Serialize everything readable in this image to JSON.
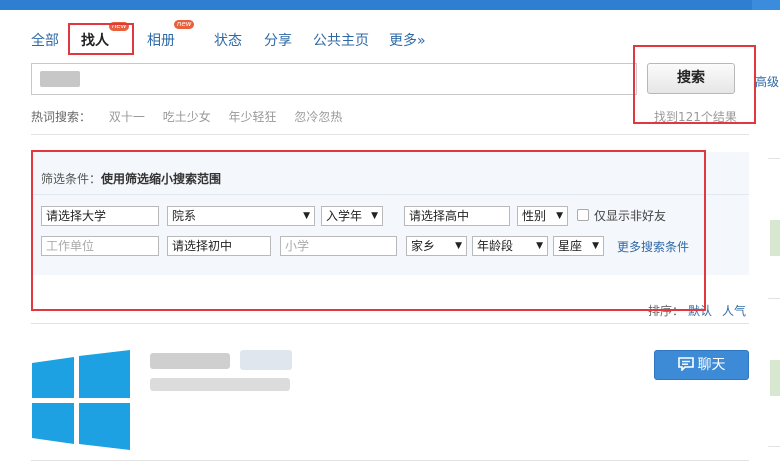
{
  "tabs": [
    {
      "label": "全部",
      "active": false
    },
    {
      "label": "找人",
      "active": true,
      "badge": "new"
    },
    {
      "label": "相册",
      "active": false,
      "badge": "new"
    },
    {
      "label": "状态",
      "active": false
    },
    {
      "label": "分享",
      "active": false
    },
    {
      "label": "公共主页",
      "active": false
    },
    {
      "label": "更多»",
      "active": false
    }
  ],
  "search": {
    "button_label": "搜索",
    "advanced_label": "高级",
    "hot_label": "热词搜索：",
    "hot_keywords": [
      "双十一",
      "吃土少女",
      "年少轻狂",
      "忽冷忽热"
    ],
    "result_count": "找到121个结果"
  },
  "filter": {
    "title_prefix": "筛选条件：",
    "title_main": "使用筛选缩小搜索范围",
    "university": "请选择大学",
    "department": "院系",
    "enroll_year": "入学年",
    "high_school": "请选择高中",
    "gender": "性别",
    "only_non_friends": "仅显示非好友",
    "work_placeholder": "工作单位",
    "middle_school": "请选择初中",
    "primary_placeholder": "小学",
    "hometown": "家乡",
    "age_range": "年龄段",
    "zodiac": "星座",
    "more_conditions": "更多搜索条件"
  },
  "sort": {
    "label": "排序：",
    "options": [
      "默认",
      "人气"
    ]
  },
  "result": {
    "chat_label": "聊天"
  },
  "colors": {
    "accent": "#2f6aa6",
    "chat_button": "#3d8bd6",
    "highlight_box": "#e0383f",
    "windows_logo": "#1da1e2"
  },
  "icons": [
    "windows-logo-icon",
    "chat-bubble-icon"
  ]
}
